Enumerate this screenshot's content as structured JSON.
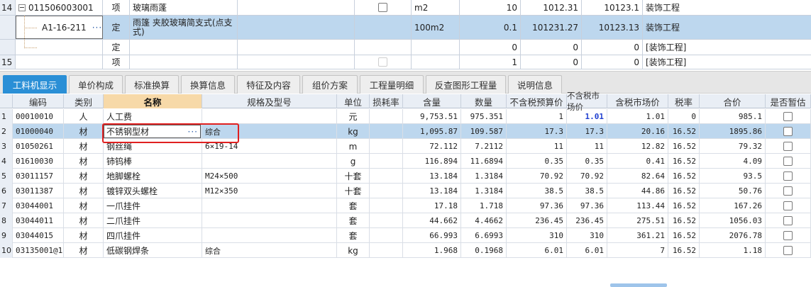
{
  "top_rows": [
    {
      "num": "14",
      "code": "011506003001",
      "type": "项",
      "name": "玻璃雨蓬",
      "unit": "m2",
      "qty": "10",
      "price": "1012.31",
      "total": "10123.1",
      "category": "装饰工程",
      "checkbox": true
    },
    {
      "num": "",
      "code": "A1-16-211",
      "type": "定",
      "name": "雨篷 夹胶玻璃简支式(点支式)",
      "unit": "100m2",
      "qty": "0.1",
      "price": "101231.27",
      "total": "10123.13",
      "category": "装饰工程",
      "checkbox": false
    },
    {
      "num": "",
      "code": "",
      "type": "定",
      "name": "",
      "unit": "",
      "qty": "0",
      "price": "0",
      "total": "0",
      "category": "[装饰工程]",
      "checkbox": false
    },
    {
      "num": "15",
      "code": "",
      "type": "项",
      "name": "",
      "unit": "",
      "qty": "1",
      "price": "0",
      "total": "0",
      "category": "[装饰工程]",
      "checkbox": true
    }
  ],
  "tabs": [
    "工料机显示",
    "单价构成",
    "标准换算",
    "换算信息",
    "特征及内容",
    "组价方案",
    "工程量明细",
    "反查图形工程量",
    "说明信息"
  ],
  "headers": [
    "编码",
    "类别",
    "名称",
    "规格及型号",
    "单位",
    "损耗率",
    "含量",
    "数量",
    "不含税预算价",
    "不含税市场价",
    "含税市场价",
    "税率",
    "合价",
    "是否暂估"
  ],
  "rows": [
    {
      "num": "1",
      "code": "00010010",
      "type": "人",
      "name": "人工费",
      "spec": "",
      "unit": "元",
      "loss": "",
      "content": "9,753.51",
      "qty": "975.351",
      "budget": "1",
      "market": "1.01",
      "taxmarket": "1.01",
      "tax": "0",
      "total": "985.1"
    },
    {
      "num": "2",
      "code": "01000040",
      "type": "材",
      "name": "不锈钢型材",
      "spec": "综合",
      "unit": "kg",
      "loss": "",
      "content": "1,095.87",
      "qty": "109.587",
      "budget": "17.3",
      "market": "17.3",
      "taxmarket": "20.16",
      "tax": "16.52",
      "total": "1895.86"
    },
    {
      "num": "3",
      "code": "01050261",
      "type": "材",
      "name": "钢丝绳",
      "spec": "6×19-14",
      "unit": "m",
      "loss": "",
      "content": "72.112",
      "qty": "7.2112",
      "budget": "11",
      "market": "11",
      "taxmarket": "12.82",
      "tax": "16.52",
      "total": "79.32"
    },
    {
      "num": "4",
      "code": "01610030",
      "type": "材",
      "name": "铈钨棒",
      "spec": "",
      "unit": "g",
      "loss": "",
      "content": "116.894",
      "qty": "11.6894",
      "budget": "0.35",
      "market": "0.35",
      "taxmarket": "0.41",
      "tax": "16.52",
      "total": "4.09"
    },
    {
      "num": "5",
      "code": "03011157",
      "type": "材",
      "name": "地脚螺栓",
      "spec": "M24×500",
      "unit": "十套",
      "loss": "",
      "content": "13.184",
      "qty": "1.3184",
      "budget": "70.92",
      "market": "70.92",
      "taxmarket": "82.64",
      "tax": "16.52",
      "total": "93.5"
    },
    {
      "num": "6",
      "code": "03011387",
      "type": "材",
      "name": "镀锌双头螺栓",
      "spec": "M12×350",
      "unit": "十套",
      "loss": "",
      "content": "13.184",
      "qty": "1.3184",
      "budget": "38.5",
      "market": "38.5",
      "taxmarket": "44.86",
      "tax": "16.52",
      "total": "50.76"
    },
    {
      "num": "7",
      "code": "03044001",
      "type": "材",
      "name": "一爪挂件",
      "spec": "",
      "unit": "套",
      "loss": "",
      "content": "17.18",
      "qty": "1.718",
      "budget": "97.36",
      "market": "97.36",
      "taxmarket": "113.44",
      "tax": "16.52",
      "total": "167.26"
    },
    {
      "num": "8",
      "code": "03044011",
      "type": "材",
      "name": "二爪挂件",
      "spec": "",
      "unit": "套",
      "loss": "",
      "content": "44.662",
      "qty": "4.4662",
      "budget": "236.45",
      "market": "236.45",
      "taxmarket": "275.51",
      "tax": "16.52",
      "total": "1056.03"
    },
    {
      "num": "9",
      "code": "03044015",
      "type": "材",
      "name": "四爪挂件",
      "spec": "",
      "unit": "套",
      "loss": "",
      "content": "66.993",
      "qty": "6.6993",
      "budget": "310",
      "market": "310",
      "taxmarket": "361.21",
      "tax": "16.52",
      "total": "2076.78"
    },
    {
      "num": "10",
      "code": "03135001@1",
      "type": "材",
      "name": "低碳钢焊条",
      "spec": "综合",
      "unit": "kg",
      "loss": "",
      "content": "1.968",
      "qty": "0.1968",
      "budget": "6.01",
      "market": "6.01",
      "taxmarket": "7",
      "tax": "16.52",
      "total": "1.18"
    }
  ]
}
